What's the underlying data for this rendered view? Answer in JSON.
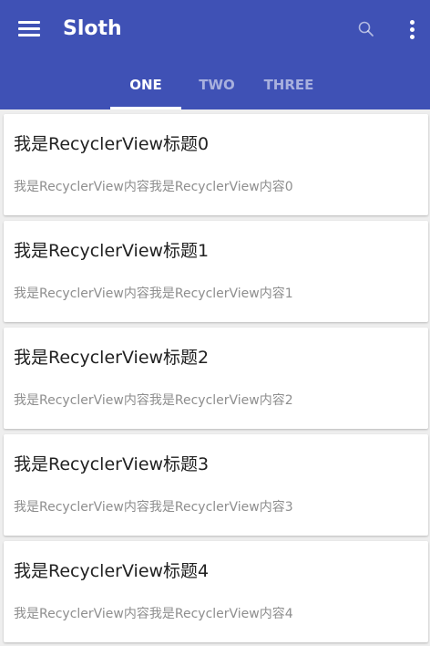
{
  "app": {
    "title": "Sloth",
    "colors": {
      "primary": "#3f51b5",
      "background": "#eeeeee",
      "card": "#ffffff",
      "title_text": "#212121",
      "content_text": "#8e8e8e"
    }
  },
  "toolbar": {
    "menu_icon": "hamburger-menu-icon",
    "search_icon": "search-icon",
    "more_icon": "more-vert-icon"
  },
  "tabs": [
    {
      "label": "ONE",
      "selected": true
    },
    {
      "label": "TWO",
      "selected": false
    },
    {
      "label": "THREE",
      "selected": false
    }
  ],
  "list": {
    "items": [
      {
        "title": "我是RecyclerView标题0",
        "content": "我是RecyclerView内容我是RecyclerView内容0"
      },
      {
        "title": "我是RecyclerView标题1",
        "content": "我是RecyclerView内容我是RecyclerView内容1"
      },
      {
        "title": "我是RecyclerView标题2",
        "content": "我是RecyclerView内容我是RecyclerView内容2"
      },
      {
        "title": "我是RecyclerView标题3",
        "content": "我是RecyclerView内容我是RecyclerView内容3"
      },
      {
        "title": "我是RecyclerView标题4",
        "content": "我是RecyclerView内容我是RecyclerView内容4"
      }
    ]
  }
}
